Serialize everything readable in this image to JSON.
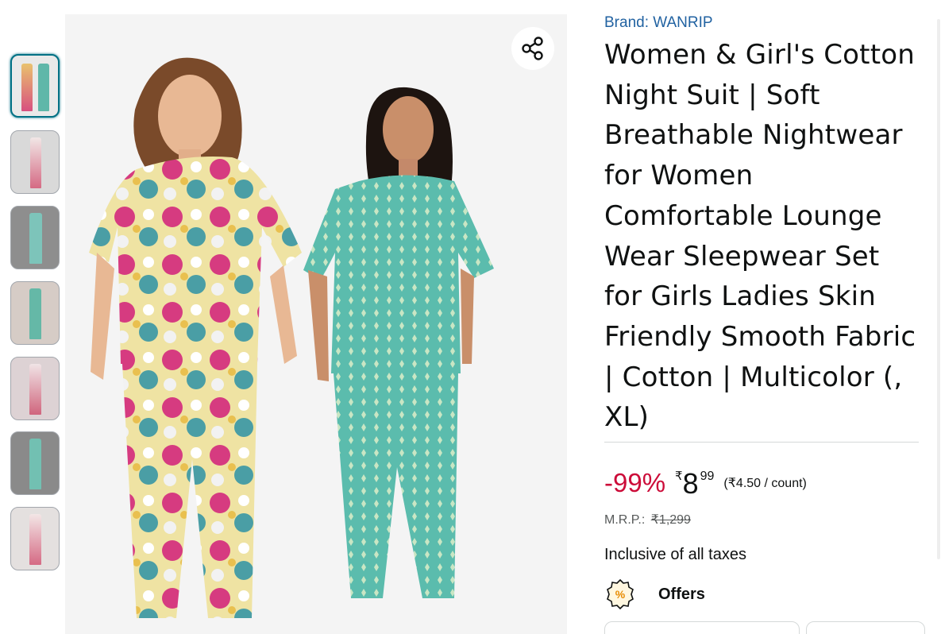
{
  "product": {
    "brand": "Brand: WANRIP",
    "title": "Women & Girl's Cotton Night Suit | Soft Breathable Nightwear for Women Comfortable Lounge Wear Sleepwear Set for Girls Ladies Skin Friendly Smooth Fabric | Cotton | Multicolor (, XL)"
  },
  "pricing": {
    "discount": "-99%",
    "currency_symbol": "₹",
    "price_whole": "8",
    "price_fraction": "99",
    "unit_price": "(₹4.50 / count)",
    "mrp_label": "M.R.P.:",
    "mrp_value": "₹1,299",
    "taxes_note": "Inclusive of all taxes"
  },
  "offers": {
    "label": "Offers",
    "icon": "percent-badge-icon"
  },
  "gallery": {
    "selected_index": 0,
    "thumbnails": [
      "thumbnail-both-models",
      "thumbnail-floral-front",
      "thumbnail-teal-gray-bg",
      "thumbnail-teal-front",
      "thumbnail-floral-pose",
      "thumbnail-teal-side",
      "thumbnail-floral-full"
    ],
    "share_icon": "share-icon"
  },
  "colors": {
    "brand_link": "#2162a1",
    "discount": "#cc0c39",
    "selected_border": "#007185",
    "text": "#0f1111",
    "muted": "#565959"
  }
}
